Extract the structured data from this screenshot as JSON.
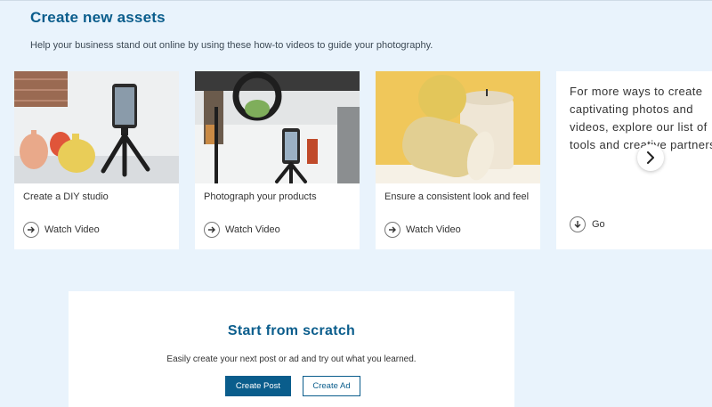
{
  "header": {
    "title": "Create new assets",
    "subtitle": "Help your business stand out online by using these how-to videos to guide your photography."
  },
  "cards": [
    {
      "caption": "Create a DIY studio",
      "action": "Watch Video",
      "photo": "phone-tripod-vases-photo"
    },
    {
      "caption": "Photograph your products",
      "action": "Watch Video",
      "photo": "ring-light-phone-photo"
    },
    {
      "caption": "Ensure a consistent look and feel",
      "action": "Watch Video",
      "photo": "candles-lemon-photo"
    }
  ],
  "more": {
    "text": "For more ways to create captivating photos and videos, explore our list of tools and creative partners.",
    "action": "Go"
  },
  "scratch": {
    "title": "Start from scratch",
    "description": "Easily create your next post or ad and try out what you learned.",
    "primary_label": "Create Post",
    "secondary_label": "Create Ad"
  },
  "colors": {
    "accent": "#0a5d8c",
    "background": "#e9f3fc",
    "card": "#ffffff"
  }
}
